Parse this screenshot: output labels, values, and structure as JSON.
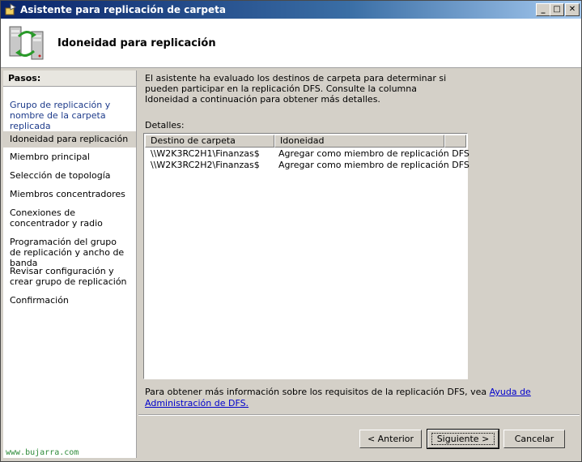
{
  "window": {
    "title": "Asistente para replicación de carpeta"
  },
  "header": {
    "title": "Idoneidad para replicación"
  },
  "steps": {
    "heading": "Pasos:",
    "items": [
      {
        "label": "Grupo de replicación y nombre de la carpeta replicada",
        "state": "link"
      },
      {
        "label": "Idoneidad para replicación",
        "state": "current"
      },
      {
        "label": "Miembro principal",
        "state": "pending"
      },
      {
        "label": "Selección de topología",
        "state": "pending"
      },
      {
        "label": "Miembros concentradores",
        "state": "pending"
      },
      {
        "label": "Conexiones de concentrador y radio",
        "state": "pending"
      },
      {
        "label": "Programación del grupo de replicación y ancho de banda",
        "state": "pending"
      },
      {
        "label": "Revisar configuración y crear grupo de replicación",
        "state": "pending"
      },
      {
        "label": "Confirmación",
        "state": "pending"
      }
    ]
  },
  "main": {
    "description": "El asistente ha evaluado los destinos de carpeta para determinar si pueden participar en la replicación DFS. Consulte la columna Idoneidad a continuación para obtener más detalles.",
    "details_label": "Detalles:",
    "columns": [
      "Destino de carpeta",
      "Idoneidad"
    ],
    "rows": [
      [
        "\\\\W2K3RC2H1\\Finanzas$",
        "Agregar como miembro de replicación DFS"
      ],
      [
        "\\\\W2K3RC2H2\\Finanzas$",
        "Agregar como miembro de replicación DFS"
      ]
    ],
    "info_text": "Para obtener más información sobre los requisitos de la replicación DFS, vea ",
    "info_link": "Ayuda de Administración de DFS."
  },
  "buttons": {
    "back": "< Anterior",
    "next": "Siguiente >",
    "cancel": "Cancelar"
  },
  "watermark": "www.bujarra.com"
}
